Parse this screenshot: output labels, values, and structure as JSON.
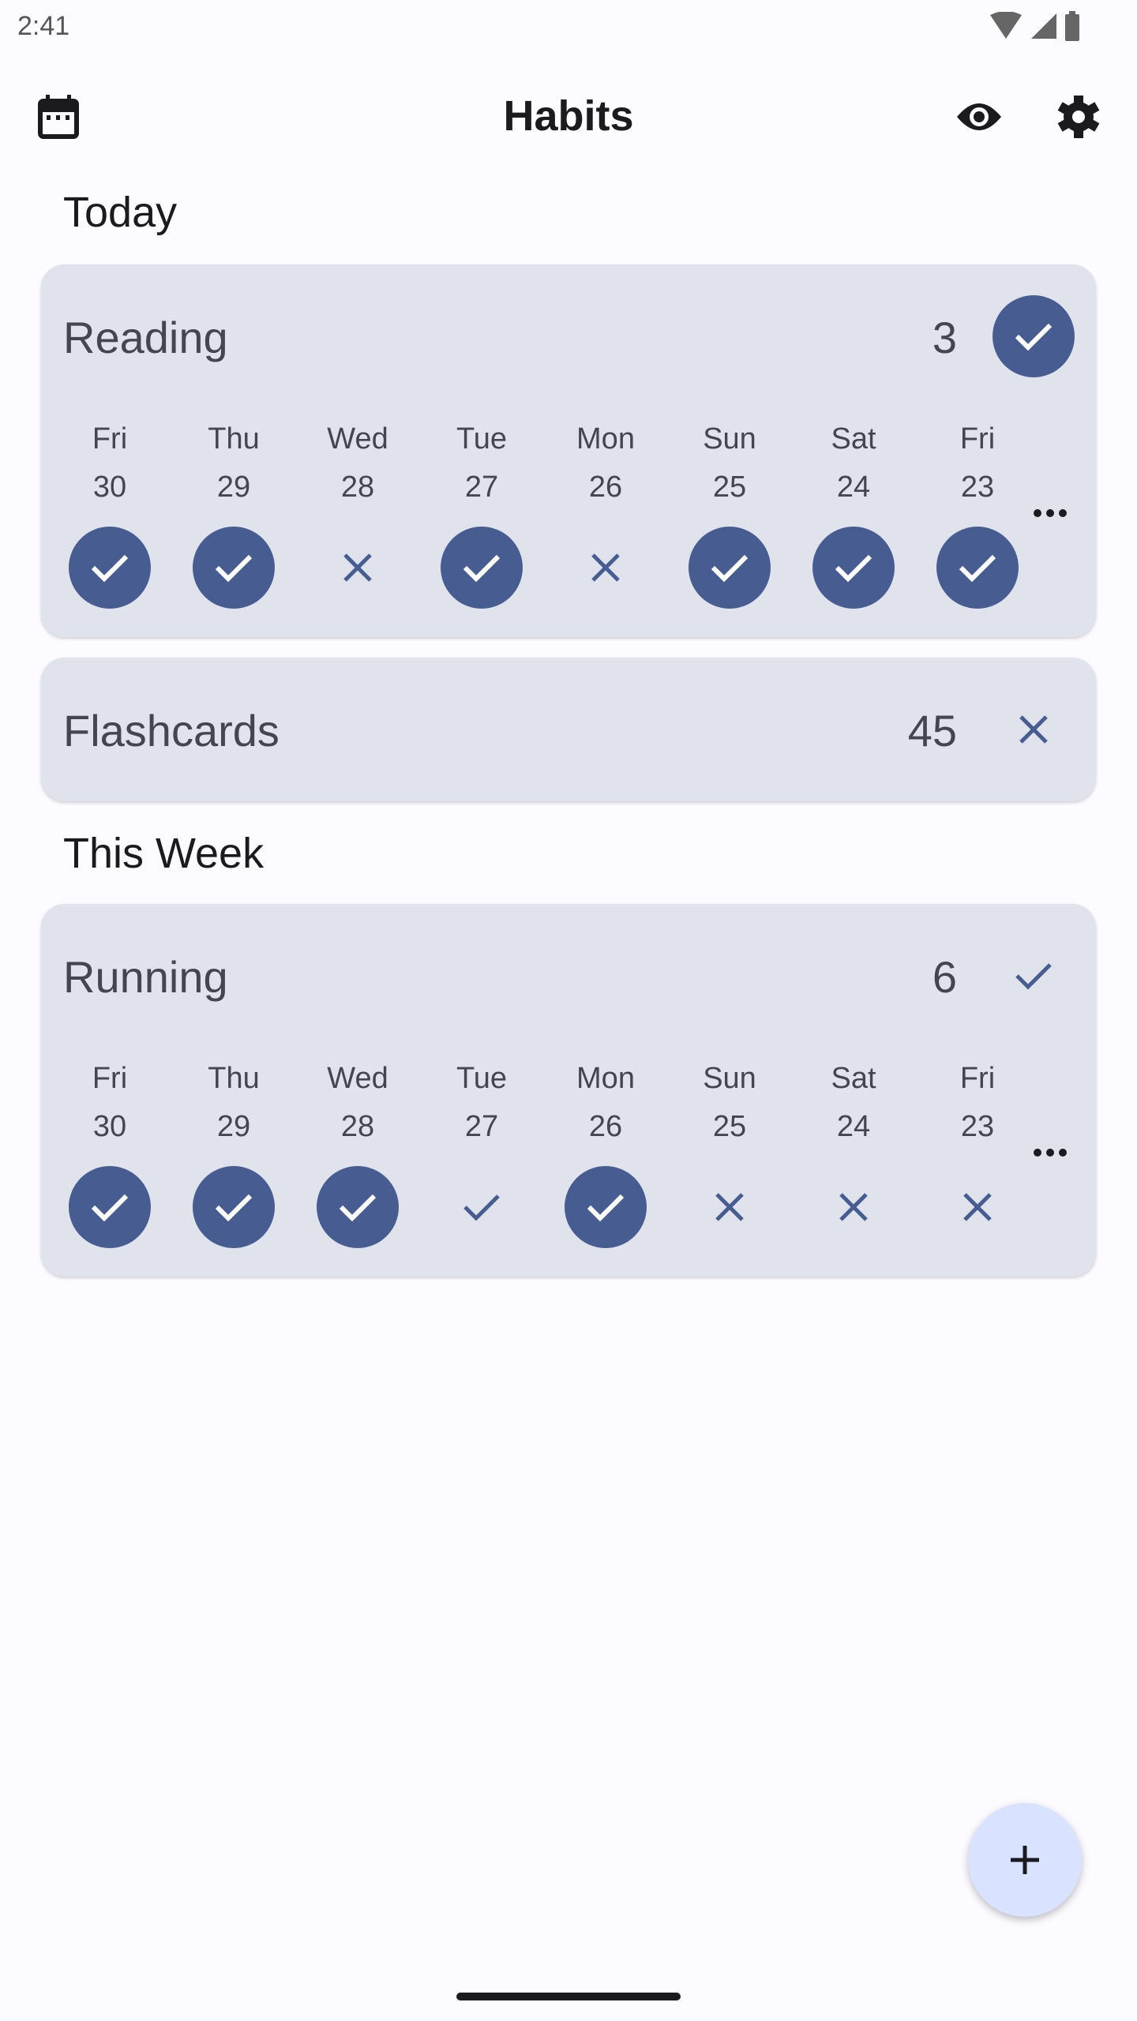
{
  "status_bar": {
    "time": "2:41",
    "icons": [
      "wifi-icon",
      "signal-icon",
      "battery-icon"
    ]
  },
  "app_bar": {
    "title": "Habits",
    "left_icon": "calendar-icon",
    "right_icons": [
      "eye-icon",
      "gear-icon"
    ]
  },
  "colors": {
    "accent": "#475d92",
    "card": "#e1e3ec",
    "background": "#fcfbff",
    "fab": "#d9e2ff"
  },
  "days": [
    {
      "d": "Fri",
      "n": "30"
    },
    {
      "d": "Thu",
      "n": "29"
    },
    {
      "d": "Wed",
      "n": "28"
    },
    {
      "d": "Tue",
      "n": "27"
    },
    {
      "d": "Mon",
      "n": "26"
    },
    {
      "d": "Sun",
      "n": "25"
    },
    {
      "d": "Sat",
      "n": "24"
    },
    {
      "d": "Fri",
      "n": "23"
    }
  ],
  "sections": [
    {
      "title": "Today",
      "habits": [
        {
          "name": "Reading",
          "count": "3",
          "today_status": "done",
          "expanded": true,
          "history": [
            "done",
            "done",
            "missed",
            "done",
            "missed",
            "done",
            "done",
            "done"
          ]
        },
        {
          "name": "Flashcards",
          "count": "45",
          "today_status": "missed",
          "expanded": false
        }
      ]
    },
    {
      "title": "This Week",
      "habits": [
        {
          "name": "Running",
          "count": "6",
          "today_status": "partial",
          "expanded": true,
          "history": [
            "done",
            "done",
            "done",
            "partial",
            "done",
            "missed",
            "missed",
            "missed"
          ]
        }
      ]
    }
  ],
  "fab": {
    "icon": "plus-icon"
  }
}
